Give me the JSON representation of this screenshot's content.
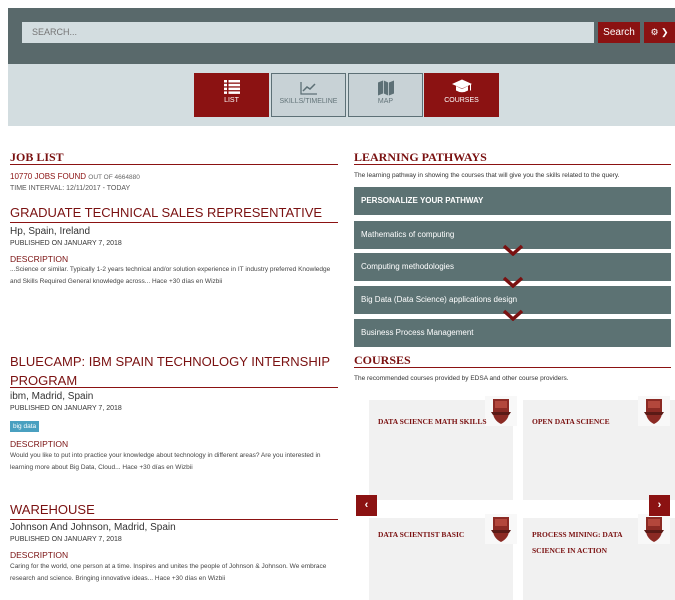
{
  "search": {
    "placeholder": "SEARCH...",
    "button_label": "Search",
    "settings_label": "⚙ ❯"
  },
  "tabs": [
    {
      "label": "LIST",
      "icon": "list-icon",
      "active": true
    },
    {
      "label": "SKILLS/TIMELINE",
      "icon": "line-chart-icon",
      "active": false
    },
    {
      "label": "MAP",
      "icon": "map-icon",
      "active": false
    },
    {
      "label": "COURSES",
      "icon": "graduation-cap-icon",
      "active": true
    }
  ],
  "job_list": {
    "title": "JOB LIST",
    "found_count": "10770 JOBS FOUND",
    "found_total": "OUT OF 4664880",
    "interval": "TIME INTERVAL: 12/11/2017 - TODAY",
    "jobs": [
      {
        "title": "GRADUATE TECHNICAL SALES REPRESENTATIVE",
        "company": "Hp, Spain, Ireland",
        "published": "PUBLISHED ON JANUARY 7, 2018",
        "desc_label": "DESCRIPTION",
        "desc": "...Science or similar. Typically 1-2 years technical and/or solution experience in IT industry preferred Knowledge and Skills Required General knowledge across... Hace +30 días en Wizbii"
      },
      {
        "title": "BLUECAMP: IBM SPAIN TECHNOLOGY INTERNSHIP PROGRAM",
        "company": "ibm, Madrid, Spain",
        "published": "PUBLISHED ON JANUARY 7, 2018",
        "tag": "big data",
        "desc_label": "DESCRIPTION",
        "desc": "Would you like to put into practice your knowledge about technology in different areas? Are you interested in learning more about Big Data, Cloud... Hace +30 días en Wizbii"
      },
      {
        "title": "WAREHOUSE",
        "company": "Johnson And Johnson, Madrid, Spain",
        "published": "PUBLISHED ON JANUARY 7, 2018",
        "desc_label": "DESCRIPTION",
        "desc": "Caring for the world, one person at a time. Inspires and unites the people of Johnson & Johnson. We embrace research and science. Bringing innovative ideas... Hace +30 días en Wizbii"
      }
    ]
  },
  "pathways": {
    "title": "LEARNING PATHWAYS",
    "description": "The learning pathway in showing the courses that will give you the skills related to the query.",
    "items": [
      "PERSONALIZE YOUR PATHWAY",
      "Mathematics of computing",
      "Computing methodologies",
      "Big Data (Data Science) applications design",
      "Business Process Management"
    ]
  },
  "courses": {
    "title": "COURSES",
    "description": "The recommended courses provided by EDSA and other course providers.",
    "items": [
      {
        "title": "DATA SCIENCE MATH SKILLS"
      },
      {
        "title": "OPEN DATA SCIENCE"
      },
      {
        "title": "DATA SCIENTIST BASIC"
      },
      {
        "title": "PROCESS MINING: DATA SCIENCE IN ACTION"
      }
    ],
    "prev_label": "‹",
    "next_label": "›"
  },
  "colors": {
    "accent": "#8b1212",
    "header_bg": "#59696b",
    "band_bg": "#d3dde0",
    "pathway_bg": "#5c7273"
  }
}
